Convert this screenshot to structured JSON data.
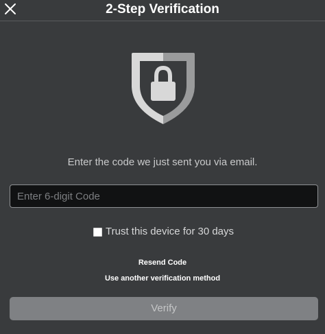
{
  "header": {
    "title": "2-Step Verification",
    "close_icon": "close-icon"
  },
  "main": {
    "shield_icon": "shield-lock-icon",
    "instruction": "Enter the code we just sent you via email.",
    "code_input": {
      "placeholder": "Enter 6-digit Code",
      "value": ""
    },
    "trust_device": {
      "label": "Trust this device for 30 days",
      "checked": false
    },
    "resend_link": "Resend Code",
    "another_method_link": "Use another verification method",
    "verify_button": "Verify"
  },
  "colors": {
    "background": "#393b3d",
    "input_background": "#111213",
    "verify_button_disabled": "#7f8184",
    "shield_light": "#d8d8d8",
    "shield_dark": "#9a9b9c"
  }
}
